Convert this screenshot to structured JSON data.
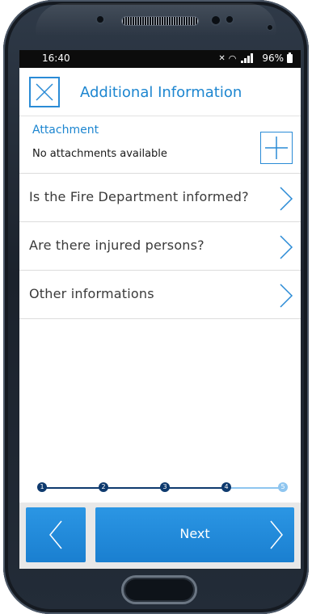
{
  "statusbar": {
    "time": "16:40",
    "battery": "96%",
    "icons": [
      "mute-icon",
      "wifi-icon",
      "signal-icon",
      "battery-icon"
    ]
  },
  "header": {
    "title": "Additional Information",
    "close_icon": "close-icon"
  },
  "attachment": {
    "label": "Attachment",
    "empty_text": "No attachments available",
    "add_icon": "plus-icon"
  },
  "menu": [
    {
      "label": "Is the Fire Department informed?",
      "icon": "chevron-right-icon"
    },
    {
      "label": "Are there injured persons?",
      "icon": "chevron-right-icon"
    },
    {
      "label": "Other informations",
      "icon": "chevron-right-icon"
    }
  ],
  "progress": {
    "steps": [
      "1",
      "2",
      "3",
      "4",
      "5"
    ],
    "current": 4,
    "total": 5
  },
  "footer": {
    "next_label": "Next",
    "prev_icon": "chevron-left-icon",
    "next_icon": "chevron-right-icon"
  },
  "colors": {
    "accent": "#1d86d0",
    "button": "#1f88d8",
    "progress_done": "#0e3a6e",
    "progress_todo": "#8ec5ef"
  }
}
